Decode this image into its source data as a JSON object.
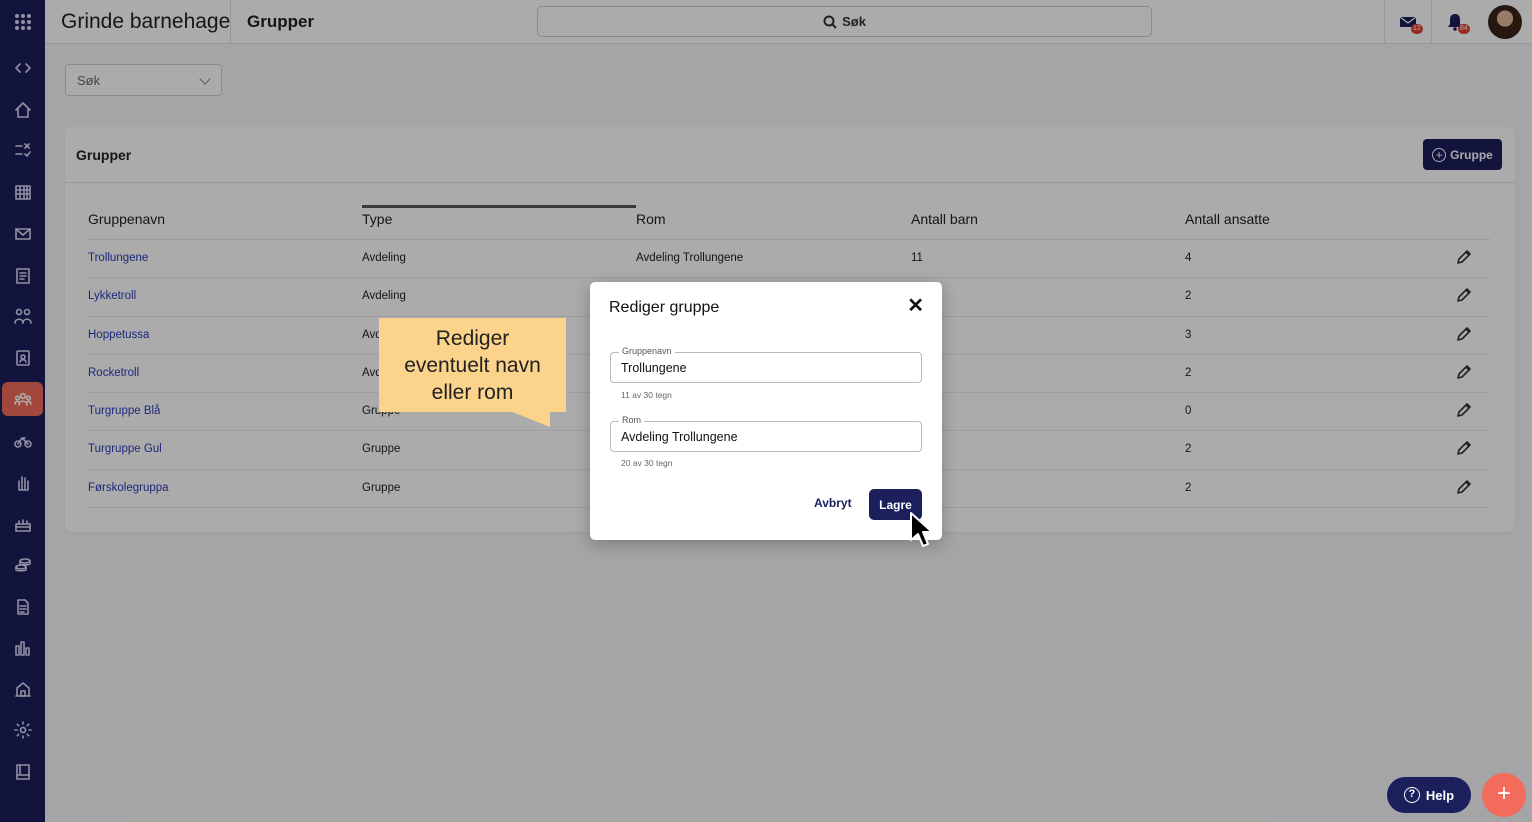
{
  "topbar": {
    "org_name": "Grinde barnehage",
    "page_name": "Grupper",
    "search_label": "Søk",
    "messages_badge": "12",
    "notifications_badge": "84"
  },
  "filter": {
    "placeholder": "Søk"
  },
  "card": {
    "title": "Grupper",
    "add_button": "Gruppe"
  },
  "table": {
    "columns": [
      "Gruppenavn",
      "Type",
      "Rom",
      "Antall barn",
      "Antall ansatte"
    ],
    "rows": [
      {
        "name": "Trollungene",
        "type": "Avdeling",
        "room": "Avdeling Trollungene",
        "children": "11",
        "staff": "4"
      },
      {
        "name": "Lykketroll",
        "type": "Avdeling",
        "room": "",
        "children": "",
        "staff": "2"
      },
      {
        "name": "Hoppetussa",
        "type": "Avd",
        "room": "",
        "children": "",
        "staff": "3"
      },
      {
        "name": "Rocketroll",
        "type": "Avd",
        "room": "",
        "children": "",
        "staff": "2"
      },
      {
        "name": "Turgruppe Blå",
        "type": "Gruppe",
        "room": "",
        "children": "",
        "staff": "0"
      },
      {
        "name": "Turgruppe Gul",
        "type": "Gruppe",
        "room": "",
        "children": "",
        "staff": "2"
      },
      {
        "name": "Førskolegruppa",
        "type": "Gruppe",
        "room": "",
        "children": "",
        "staff": "2"
      }
    ]
  },
  "dialog": {
    "title": "Rediger gruppe",
    "close": "✕",
    "name_label": "Gruppenavn",
    "name_value": "Trollungene",
    "name_helper": "11 av 30 tegn",
    "room_label": "Rom",
    "room_value": "Avdeling Trollungene",
    "room_helper": "20 av 30 tegn",
    "cancel": "Avbryt",
    "save": "Lagre"
  },
  "callout": {
    "line1": "Rediger",
    "line2": "eventuelt navn",
    "line3": "eller rom"
  },
  "help": {
    "label": "Help",
    "icon": "?"
  },
  "fab": {
    "label": "+"
  },
  "colors": {
    "navy": "#1b1f5c",
    "accent": "#f26b5b",
    "callout": "#fbd38b",
    "link": "#2a3bb8"
  }
}
